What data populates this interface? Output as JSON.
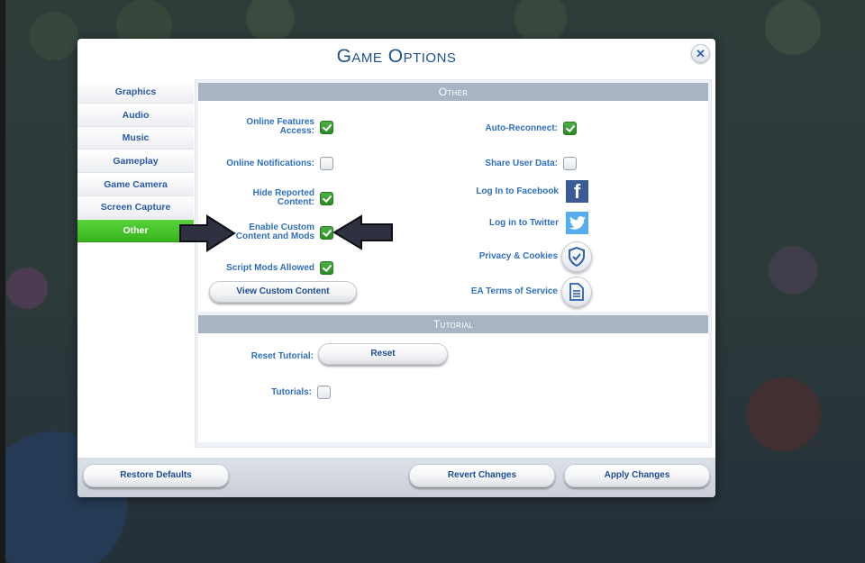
{
  "dialog": {
    "title": "Game Options",
    "close_icon": "close-icon"
  },
  "sidebar": {
    "items": [
      {
        "label": "Graphics",
        "active": false
      },
      {
        "label": "Audio",
        "active": false
      },
      {
        "label": "Music",
        "active": false
      },
      {
        "label": "Gameplay",
        "active": false
      },
      {
        "label": "Game Camera",
        "active": false
      },
      {
        "label": "Screen Capture",
        "active": false
      },
      {
        "label": "Other",
        "active": true
      }
    ]
  },
  "other_section": {
    "header": "Other",
    "left_options": [
      {
        "label_line1": "Online Features",
        "label_line2": "Access:",
        "checked": true
      },
      {
        "label_line1": "Online Notifications:",
        "label_line2": "",
        "checked": false
      },
      {
        "label_line1": "Hide Reported",
        "label_line2": "Content:",
        "checked": true
      },
      {
        "label_line1": "Enable Custom",
        "label_line2": "Content and Mods",
        "checked": true
      },
      {
        "label_line1": "Script Mods Allowed",
        "label_line2": "",
        "checked": true
      }
    ],
    "view_custom_content_button": "View Custom Content",
    "right_options": [
      {
        "label": "Auto-Reconnect:",
        "checked": true
      },
      {
        "label": "Share User Data:",
        "checked": false
      }
    ],
    "links": [
      {
        "label": "Log In to Facebook",
        "icon": "facebook-icon"
      },
      {
        "label": "Log in to Twitter",
        "icon": "twitter-icon"
      },
      {
        "label": "Privacy & Cookies",
        "icon": "shield-check-icon"
      },
      {
        "label": "EA Terms of Service",
        "icon": "document-icon"
      }
    ]
  },
  "tutorial_section": {
    "header": "Tutorial",
    "reset_label": "Reset Tutorial:",
    "reset_button": "Reset",
    "tutorials_label": "Tutorials:",
    "tutorials_checked": false
  },
  "footer": {
    "restore_defaults": "Restore Defaults",
    "revert_changes": "Revert Changes",
    "apply_changes": "Apply Changes"
  },
  "annotations": {
    "arrows": [
      "arrow-right-icon",
      "arrow-left-icon"
    ],
    "arrow_color": "#2e3140"
  },
  "colors": {
    "accent_green": "#3fbf26",
    "label_blue": "#2f6fbf",
    "title_blue": "#1d4f91",
    "header_gray": "#a8b3c4"
  }
}
